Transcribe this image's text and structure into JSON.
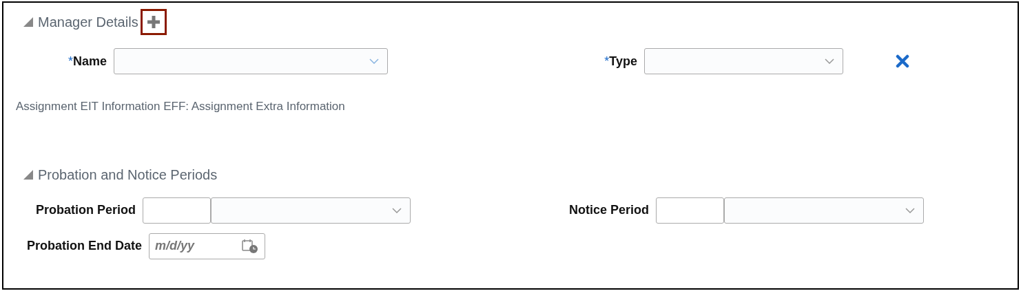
{
  "manager_details": {
    "title": "Manager Details",
    "expanded": true,
    "fields": [
      {
        "label": "Name",
        "required_mark": "*"
      },
      {
        "label": "Type",
        "required_mark": "*"
      }
    ]
  },
  "info_text": "Assignment EIT Information EFF: Assignment Extra Information",
  "probation": {
    "title": "Probation and Notice Periods",
    "expanded": true,
    "probation_period": {
      "label": "Probation Period"
    },
    "notice_period": {
      "label": "Notice Period"
    },
    "end_date": {
      "label": "Probation End Date",
      "placeholder": "m/d/yy"
    }
  }
}
